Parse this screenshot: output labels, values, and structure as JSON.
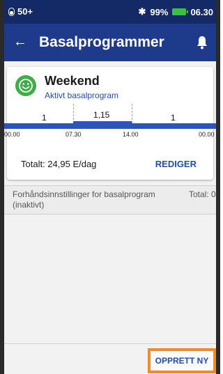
{
  "status_bar": {
    "pod_label": "50+",
    "battery_percent": "99%",
    "time": "06.30",
    "battery_color": "#3fbf3f"
  },
  "app_bar": {
    "title": "Basalprogrammer",
    "back_icon": "arrow-left-icon",
    "bell_icon": "bell-icon"
  },
  "program_card": {
    "name": "Weekend",
    "status": "Aktivt basalprogram",
    "icon": "smiley-icon",
    "segments": [
      {
        "value": "1",
        "start": "00.00",
        "end": "07.30"
      },
      {
        "value": "1,15",
        "start": "07.30",
        "end": "14.00"
      },
      {
        "value": "1",
        "start": "14.00",
        "end": "00.00"
      }
    ],
    "time_labels": [
      "00.00",
      "07.30",
      "14.00",
      "00.00"
    ],
    "total": "Totalt: 24,95 E/dag",
    "edit_label": "REDIGER"
  },
  "presets_section": {
    "line1": "Forhåndsinnstillinger for basalprogram",
    "line2": "(inaktivt)",
    "total": "Total: 0"
  },
  "bottom": {
    "create_label": "OPPRETT NY"
  },
  "colors": {
    "status_bar": "#142a66",
    "app_bar": "#1e3a8a",
    "accent_link": "#1e4fb0",
    "highlight_border": "#f08a2c",
    "smiley": "#3fae49"
  }
}
